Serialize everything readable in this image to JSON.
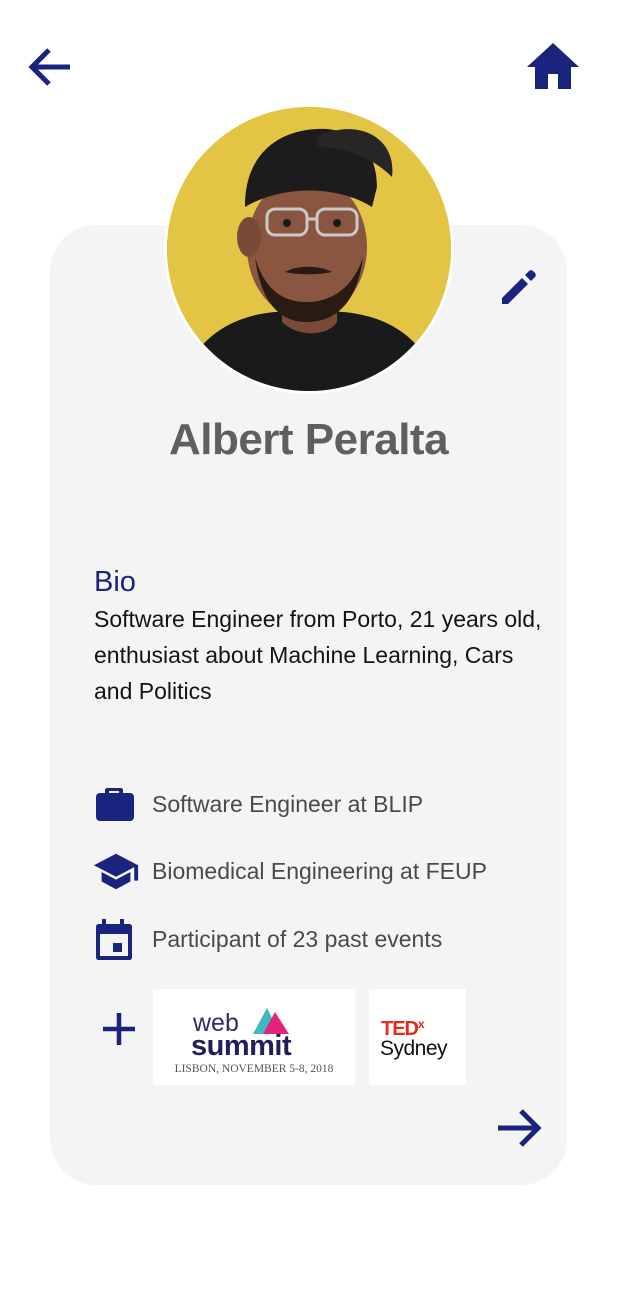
{
  "profile": {
    "name": "Albert Peralta"
  },
  "bio": {
    "title": "Bio",
    "text": "Software Engineer from Porto, 21 years old, enthusiast about Machine Learning, Cars and Politics"
  },
  "info": {
    "job": "Software Engineer at BLIP",
    "education": "Biomedical Engineering at FEUP",
    "events": "Participant of 23 past events"
  },
  "events": {
    "websummit": {
      "line1": "web",
      "line2": "summit",
      "caption": "LISBON, NOVEMBER 5-8, 2018"
    },
    "tedx": {
      "brand": "TED",
      "superscript": "x",
      "city": "Sydney"
    }
  },
  "colors": {
    "accent": "#1a237e",
    "card_bg": "#f4f4f4",
    "avatar_bg": "#e3c444",
    "ted_red": "#e62b1e",
    "websummit_pink": "#e4237c",
    "websummit_teal": "#3fb8c3"
  },
  "icons": {
    "back": "arrow-left-icon",
    "home": "home-icon",
    "edit": "pencil-icon",
    "job": "briefcase-icon",
    "education": "graduation-cap-icon",
    "events": "calendar-icon",
    "add": "plus-icon",
    "next": "arrow-right-icon"
  }
}
